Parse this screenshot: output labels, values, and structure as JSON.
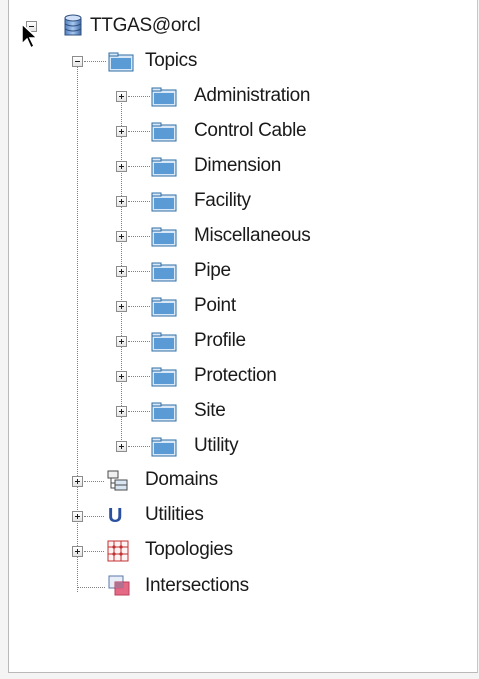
{
  "tree": {
    "root": {
      "label": "TTGAS@orcl",
      "icon": "database-icon",
      "expanded": true
    },
    "topics": {
      "label": "Topics",
      "icon": "folder-icon",
      "expanded": true,
      "children": [
        {
          "label": "Administration"
        },
        {
          "label": "Control Cable"
        },
        {
          "label": "Dimension"
        },
        {
          "label": "Facility"
        },
        {
          "label": "Miscellaneous"
        },
        {
          "label": "Pipe"
        },
        {
          "label": "Point"
        },
        {
          "label": "Profile"
        },
        {
          "label": "Protection"
        },
        {
          "label": "Site"
        },
        {
          "label": "Utility"
        }
      ]
    },
    "domains": {
      "label": "Domains",
      "icon": "domains-icon"
    },
    "utilities": {
      "label": "Utilities",
      "icon": "utilities-icon"
    },
    "topologies": {
      "label": "Topologies",
      "icon": "topologies-icon"
    },
    "intersections": {
      "label": "Intersections",
      "icon": "intersections-icon"
    }
  },
  "colors": {
    "folder": "#5b9bd5",
    "folder_dark": "#2e6da4",
    "line": "#808080"
  }
}
